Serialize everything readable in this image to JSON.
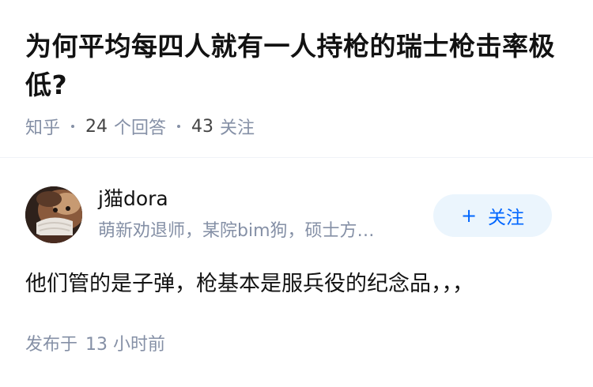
{
  "question": {
    "title": "为何平均每四人就有一人持枪的瑞士枪击率极低?",
    "source": "知乎",
    "answer_count": "24",
    "answer_label": "个回答",
    "follower_count": "43",
    "follower_label": "关注"
  },
  "answer": {
    "author_name": "j猫dora",
    "author_bio": "萌新劝退师，某院bim狗，硕士方…",
    "follow_button_label": "关注",
    "follow_button_icon": "plus-icon",
    "content": "他们管的是子弹，枪基本是服兵役的纪念品，，，",
    "publish_prefix": "发布于",
    "publish_time": "13 小时前"
  },
  "colors": {
    "accent": "#0066ff",
    "follow_bg": "#ebf5fd",
    "meta": "#8590a6",
    "text": "#121212"
  }
}
